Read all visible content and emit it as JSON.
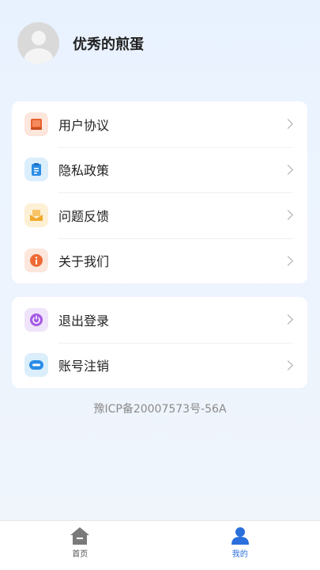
{
  "profile": {
    "name": "优秀的煎蛋"
  },
  "menu_group_1": [
    {
      "label": "用户协议",
      "icon": "book-icon",
      "icon_color": "#e8622f",
      "icon_bg": "#fde6dc"
    },
    {
      "label": "隐私政策",
      "icon": "clipboard-icon",
      "icon_color": "#2b8de6",
      "icon_bg": "#dbeefc"
    },
    {
      "label": "问题反馈",
      "icon": "mail-icon",
      "icon_color": "#f2a92d",
      "icon_bg": "#fdf0d4"
    },
    {
      "label": "关于我们",
      "icon": "info-icon",
      "icon_color": "#ee6a34",
      "icon_bg": "#fde6dc"
    }
  ],
  "menu_group_2": [
    {
      "label": "退出登录",
      "icon": "power-icon",
      "icon_color": "#a55ae6",
      "icon_bg": "#efe4fb"
    },
    {
      "label": "账号注销",
      "icon": "toggle-icon",
      "icon_color": "#2b8de6",
      "icon_bg": "#dbeefc"
    }
  ],
  "icp": "豫ICP备20007573号-56A",
  "tabbar": {
    "home_label": "首页",
    "mine_label": "我的",
    "active_color": "#2a6fdb",
    "inactive_color": "#7a7a7a"
  }
}
